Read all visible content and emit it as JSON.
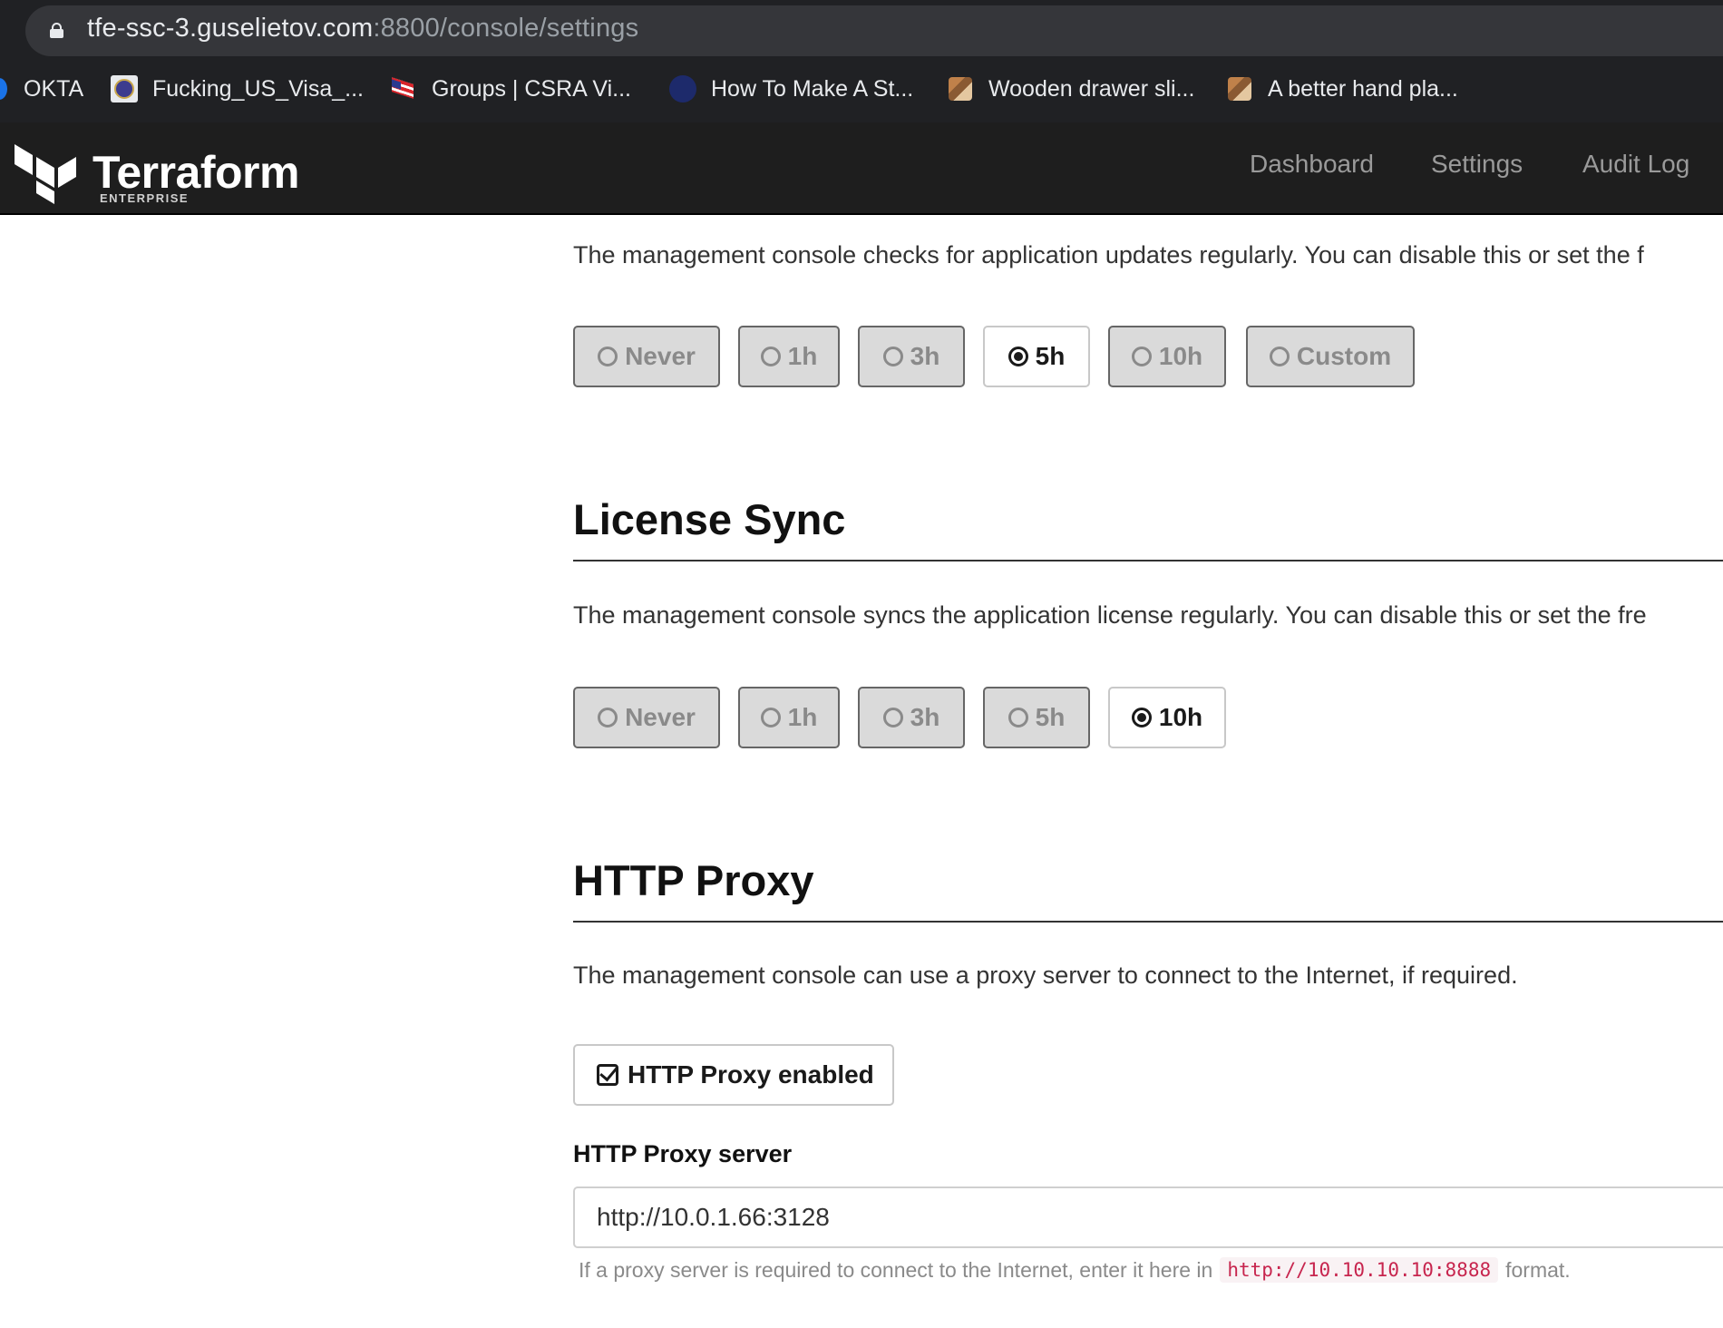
{
  "browser": {
    "url_host": "tfe-ssc-3.guselietov.com",
    "url_rest": ":8800/console/settings",
    "bookmarks": [
      {
        "label": "OKTA"
      },
      {
        "label": "Fucking_US_Visa_..."
      },
      {
        "label": "Groups | CSRA Vi..."
      },
      {
        "label": "How To Make A St..."
      },
      {
        "label": "Wooden drawer sli..."
      },
      {
        "label": "A better hand pla..."
      }
    ]
  },
  "header": {
    "logo_text": "Terraform",
    "logo_sub": "ENTERPRISE",
    "nav": [
      {
        "label": "Dashboard"
      },
      {
        "label": "Settings"
      },
      {
        "label": "Audit Log"
      }
    ]
  },
  "app_updates": {
    "description": "The management console checks for application updates regularly. You can disable this or set the f",
    "options": [
      "Never",
      "1h",
      "3h",
      "5h",
      "10h",
      "Custom"
    ],
    "selected": "5h"
  },
  "license_sync": {
    "title": "License Sync",
    "description": "The management console syncs the application license regularly. You can disable this or set the fre",
    "options": [
      "Never",
      "1h",
      "3h",
      "5h",
      "10h"
    ],
    "selected": "10h"
  },
  "http_proxy": {
    "title": "HTTP Proxy",
    "description": "The management console can use a proxy server to connect to the Internet, if required.",
    "enabled_label": "HTTP Proxy enabled",
    "enabled": true,
    "server_label": "HTTP Proxy server",
    "server_value": "http://10.0.1.66:3128",
    "help_prefix": "If a proxy server is required to connect to the Internet, enter it here in",
    "help_code": "http://10.10.10.10:8888",
    "help_suffix": "format."
  }
}
